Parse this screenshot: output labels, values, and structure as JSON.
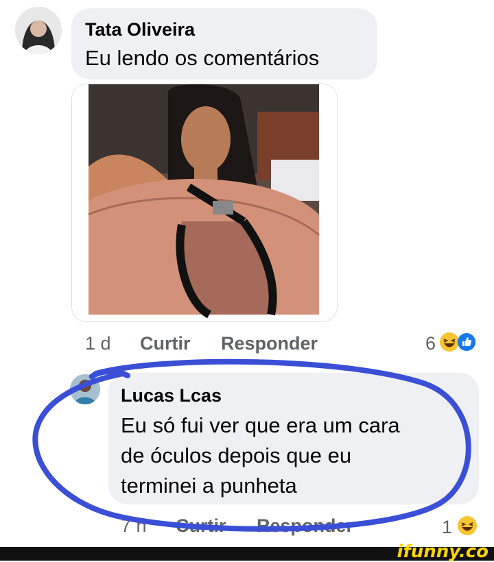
{
  "comments": [
    {
      "author": "Tata Oliveira",
      "text": "Eu lendo os comentários",
      "time": "1 d",
      "like_label": "Curtir",
      "reply_label": "Responder",
      "reaction_count": "6",
      "reactions": [
        "haha-icon",
        "like-icon"
      ]
    },
    {
      "author": "Lucas Lcas",
      "text_lines": [
        "Eu só fui ver que era um cara",
        "de óculos depois que eu",
        "terminei a punheta"
      ],
      "time": "7 h",
      "like_label": "Curtir",
      "reply_label": "Responder",
      "reaction_count": "1",
      "reactions": [
        "haha-icon"
      ]
    }
  ],
  "watermark": "ifunny.co",
  "colors": {
    "bubble": "#eef0f3",
    "annotation_circle": "#3b4fd6",
    "reaction_yellow": "#f7c531",
    "like_blue": "#1877f2",
    "footer": "#111111",
    "watermark": "#ffd400"
  }
}
